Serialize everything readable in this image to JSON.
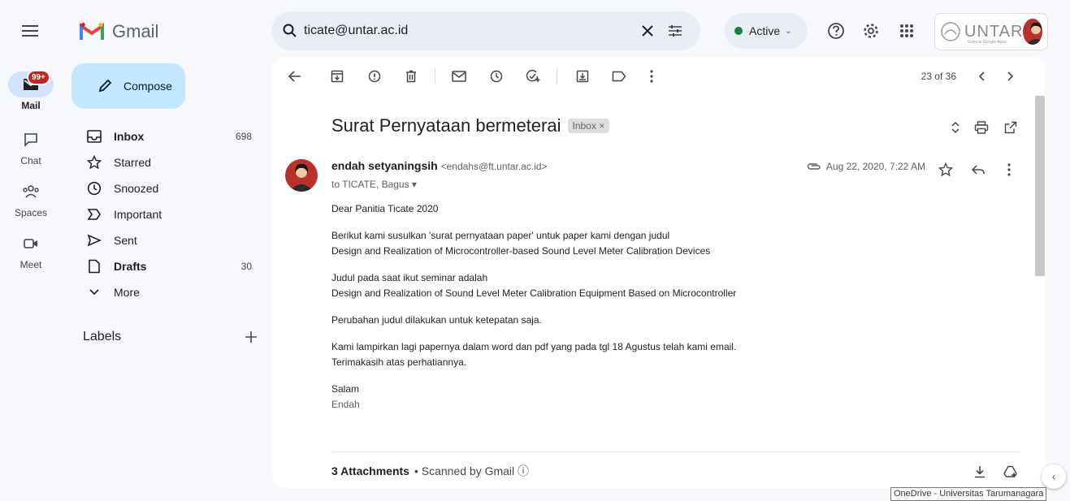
{
  "header": {
    "app_name": "Gmail",
    "search_value": "ticate@untar.ac.id",
    "status": "Active",
    "org_name": "UNTAR",
    "org_tagline": "Goes to Google Apps"
  },
  "rail": {
    "mail": "Mail",
    "badge": "99+",
    "chat": "Chat",
    "spaces": "Spaces",
    "meet": "Meet"
  },
  "nav": {
    "compose": "Compose",
    "items": [
      {
        "label": "Inbox",
        "count": "698"
      },
      {
        "label": "Starred",
        "count": ""
      },
      {
        "label": "Snoozed",
        "count": ""
      },
      {
        "label": "Important",
        "count": ""
      },
      {
        "label": "Sent",
        "count": ""
      },
      {
        "label": "Drafts",
        "count": "30"
      },
      {
        "label": "More",
        "count": ""
      }
    ],
    "labels_title": "Labels"
  },
  "email": {
    "pager": "23 of 36",
    "subject": "Surat Pernyataan bermeterai",
    "tag": "Inbox ×",
    "sender_name": "endah setyaningsih",
    "sender_email": "<endahs@ft.untar.ac.id>",
    "to": "to TICATE, Bagus ▾",
    "date": "Aug 22, 2020, 7:22 AM",
    "body": [
      "Dear Panitia Ticate 2020",
      "Berikut kami susulkan 'surat pernyataan paper' untuk paper kami dengan judul",
      "Design and Realization of Microcontroller-based Sound Level Meter Calibration Devices",
      "Judul pada saat ikut seminar adalah",
      "Design and Realization of Sound Level Meter Calibration Equipment Based on Microcontroller",
      "Perubahan judul dilakukan untuk ketepatan saja.",
      "Kami lampirkan lagi papernya dalam word dan pdf yang pada tgl 18 Agustus telah kami email.",
      "Terimakasih atas perhatiannya.",
      "Salam",
      "Endah"
    ],
    "attachments": "3 Attachments",
    "scanned": "•  Scanned by Gmail ⓘ"
  },
  "tooltip": "OneDrive - Universitas Tarumanagara"
}
